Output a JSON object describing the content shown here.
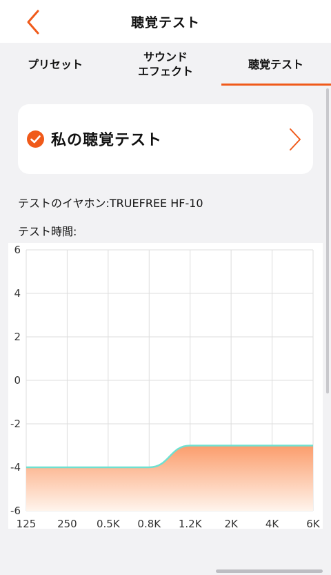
{
  "header": {
    "title": "聴覚テスト",
    "back_icon": "chevron-left-icon"
  },
  "tabs": [
    {
      "label": "プリセット",
      "active": false
    },
    {
      "label": "サウンド\nエフェクト",
      "active": false
    },
    {
      "label": "聴覚テスト",
      "active": true
    }
  ],
  "card": {
    "title": "私の聴覚テスト",
    "check_icon": "check-circle-icon",
    "chevron_icon": "chevron-right-icon"
  },
  "info": {
    "earphone": "テストのイヤホン:TRUEFREE HF-10",
    "time": "テスト時間:"
  },
  "colors": {
    "accent": "#f05a1a",
    "line": "#6fe0d0",
    "fill_top": "#fb9d6c",
    "fill_bottom": "#fff4ec",
    "grid": "#dddddd"
  },
  "chart_data": {
    "type": "area",
    "categories": [
      "125",
      "250",
      "0.5K",
      "0.8K",
      "1.2K",
      "2K",
      "4K",
      "6K"
    ],
    "yticks": [
      "6",
      "4",
      "2",
      "0",
      "-2",
      "-4",
      "-6"
    ],
    "ylim": [
      -6,
      6
    ],
    "values": [
      -4,
      -4,
      -4,
      -4,
      -3,
      -3,
      -3,
      -3
    ],
    "grid": true,
    "title": "",
    "xlabel": "",
    "ylabel": ""
  }
}
